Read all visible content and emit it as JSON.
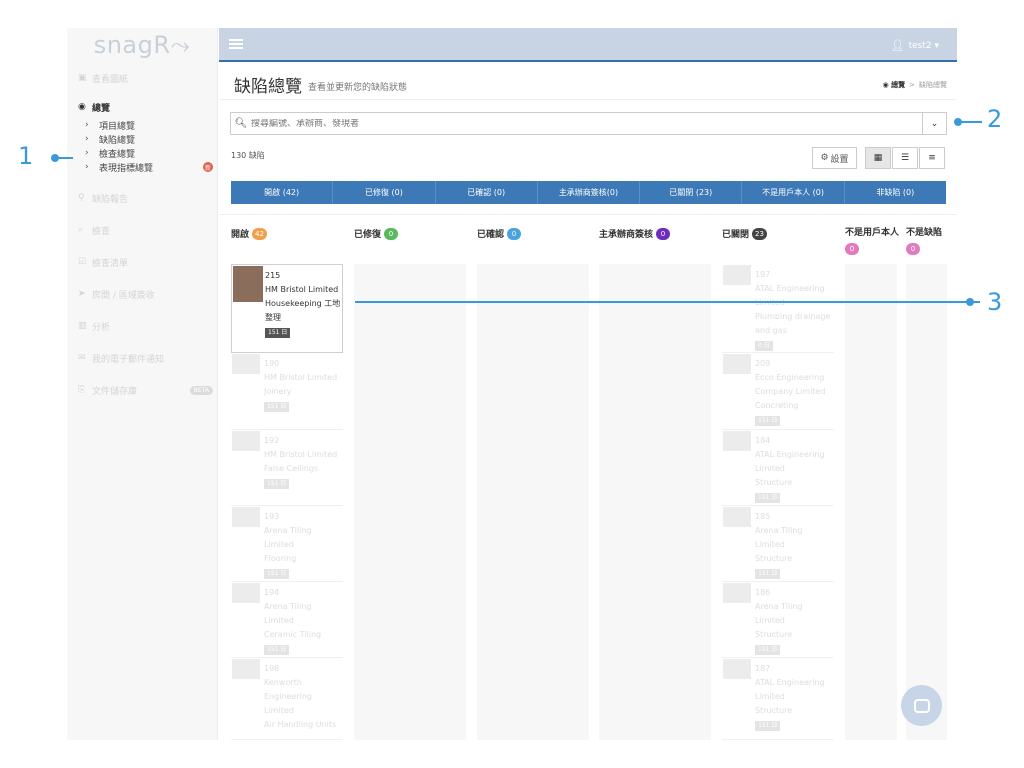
{
  "app": {
    "logo": "snagR",
    "logo_mark": "⤳"
  },
  "sidebar": {
    "items": [
      {
        "label": "查看圖紙",
        "icon": "image-icon",
        "glyph": "▣"
      },
      {
        "label": "總覽",
        "icon": "dashboard-icon",
        "glyph": "◉",
        "active": true,
        "subitems": [
          {
            "label": "項目總覽"
          },
          {
            "label": "缺陷總覽"
          },
          {
            "label": "檢查總覽"
          },
          {
            "label": "表現指標總覽",
            "badge": "新"
          }
        ]
      },
      {
        "label": "缺陷報告",
        "icon": "map-marker-icon",
        "glyph": "⚲"
      },
      {
        "label": "檢查",
        "icon": "search-icon",
        "glyph": "⌕"
      },
      {
        "label": "檢查清單",
        "icon": "checklist-icon",
        "glyph": "☑"
      },
      {
        "label": "房間 / 區域簽收",
        "icon": "paper-plane-icon",
        "glyph": "➤"
      },
      {
        "label": "分析",
        "icon": "bar-chart-icon",
        "glyph": "▥"
      },
      {
        "label": "我的電子郵件通知",
        "icon": "envelope-icon",
        "glyph": "✉"
      },
      {
        "label": "文件儲存庫",
        "icon": "document-icon",
        "glyph": "⎘",
        "badge": "BETA"
      }
    ]
  },
  "topbar": {
    "user": "test2 ▾"
  },
  "header": {
    "title": "缺陷總覽",
    "subtitle": "查看並更新您的缺陷狀態",
    "breadcrumb": {
      "home": "總覽",
      "sep": ">",
      "current": "缺陷總覽"
    }
  },
  "search": {
    "placeholder": "搜尋編號、承辦商、發現者"
  },
  "summary": {
    "count": "130 缺陷"
  },
  "toolbar": {
    "settings_label": "設置"
  },
  "tabs": [
    "開啟 (42)",
    "已修復 (0)",
    "已確認 (0)",
    "主承辦商簽核(0)",
    "已關閉 (23)",
    "不是用戶本人 (0)",
    "非缺陷 (0)"
  ],
  "columns": [
    {
      "label": "開啟",
      "count": "42",
      "color": "#f0a04b"
    },
    {
      "label": "已修復",
      "count": "0",
      "color": "#5cb85c"
    },
    {
      "label": "已確認",
      "count": "0",
      "color": "#4aa3df"
    },
    {
      "label": "主承辦商簽核",
      "count": "0",
      "color": "#6f2dbd"
    },
    {
      "label": "已關閉",
      "count": "23",
      "color": "#444444"
    },
    {
      "label": "不是用戶本人",
      "count": "0",
      "color": "#e07bc0"
    },
    {
      "label": "不是缺陷",
      "count": "0",
      "color": "#e07bc0"
    }
  ],
  "cards_open": [
    {
      "id": "215",
      "company": "HM Bristol Limited",
      "trade": "Housekeeping 工地整理",
      "days": "151 日",
      "highlight": true
    },
    {
      "id": "190",
      "company": "HM Bristol Limited",
      "trade": "Joinery",
      "days": "151 日"
    },
    {
      "id": "192",
      "company": "HM Bristol Limited",
      "trade": "False Ceilings",
      "days": "151 日"
    },
    {
      "id": "193",
      "company": "Arena Tiling Limited",
      "trade": "Flooring",
      "days": "151 日"
    },
    {
      "id": "194",
      "company": "Arena Tiling Limited",
      "trade": "Ceramic Tiling",
      "days": "151 日"
    },
    {
      "id": "198",
      "company": "Kenworth Engineering Limited",
      "trade": "Air Handling Units",
      "days": ""
    }
  ],
  "cards_closed": [
    {
      "id": "197",
      "company": "ATAL Engineering Limited",
      "trade": "Plumbing drainage and gas",
      "days": "0 日"
    },
    {
      "id": "209",
      "company": "Ecco Engineering Company Limited",
      "trade": "Concreting",
      "days": "151 日"
    },
    {
      "id": "184",
      "company": "ATAL Engineering Limited",
      "trade": "Structure",
      "days": "151 日"
    },
    {
      "id": "185",
      "company": "Arena Tiling Limited",
      "trade": "Structure",
      "days": "151 日"
    },
    {
      "id": "186",
      "company": "Arena Tiling Limited",
      "trade": "Structure",
      "days": "151 日"
    },
    {
      "id": "187",
      "company": "ATAL Engineering Limited",
      "trade": "Structure",
      "days": "151 日"
    }
  ],
  "callouts": [
    "1",
    "2",
    "3"
  ]
}
